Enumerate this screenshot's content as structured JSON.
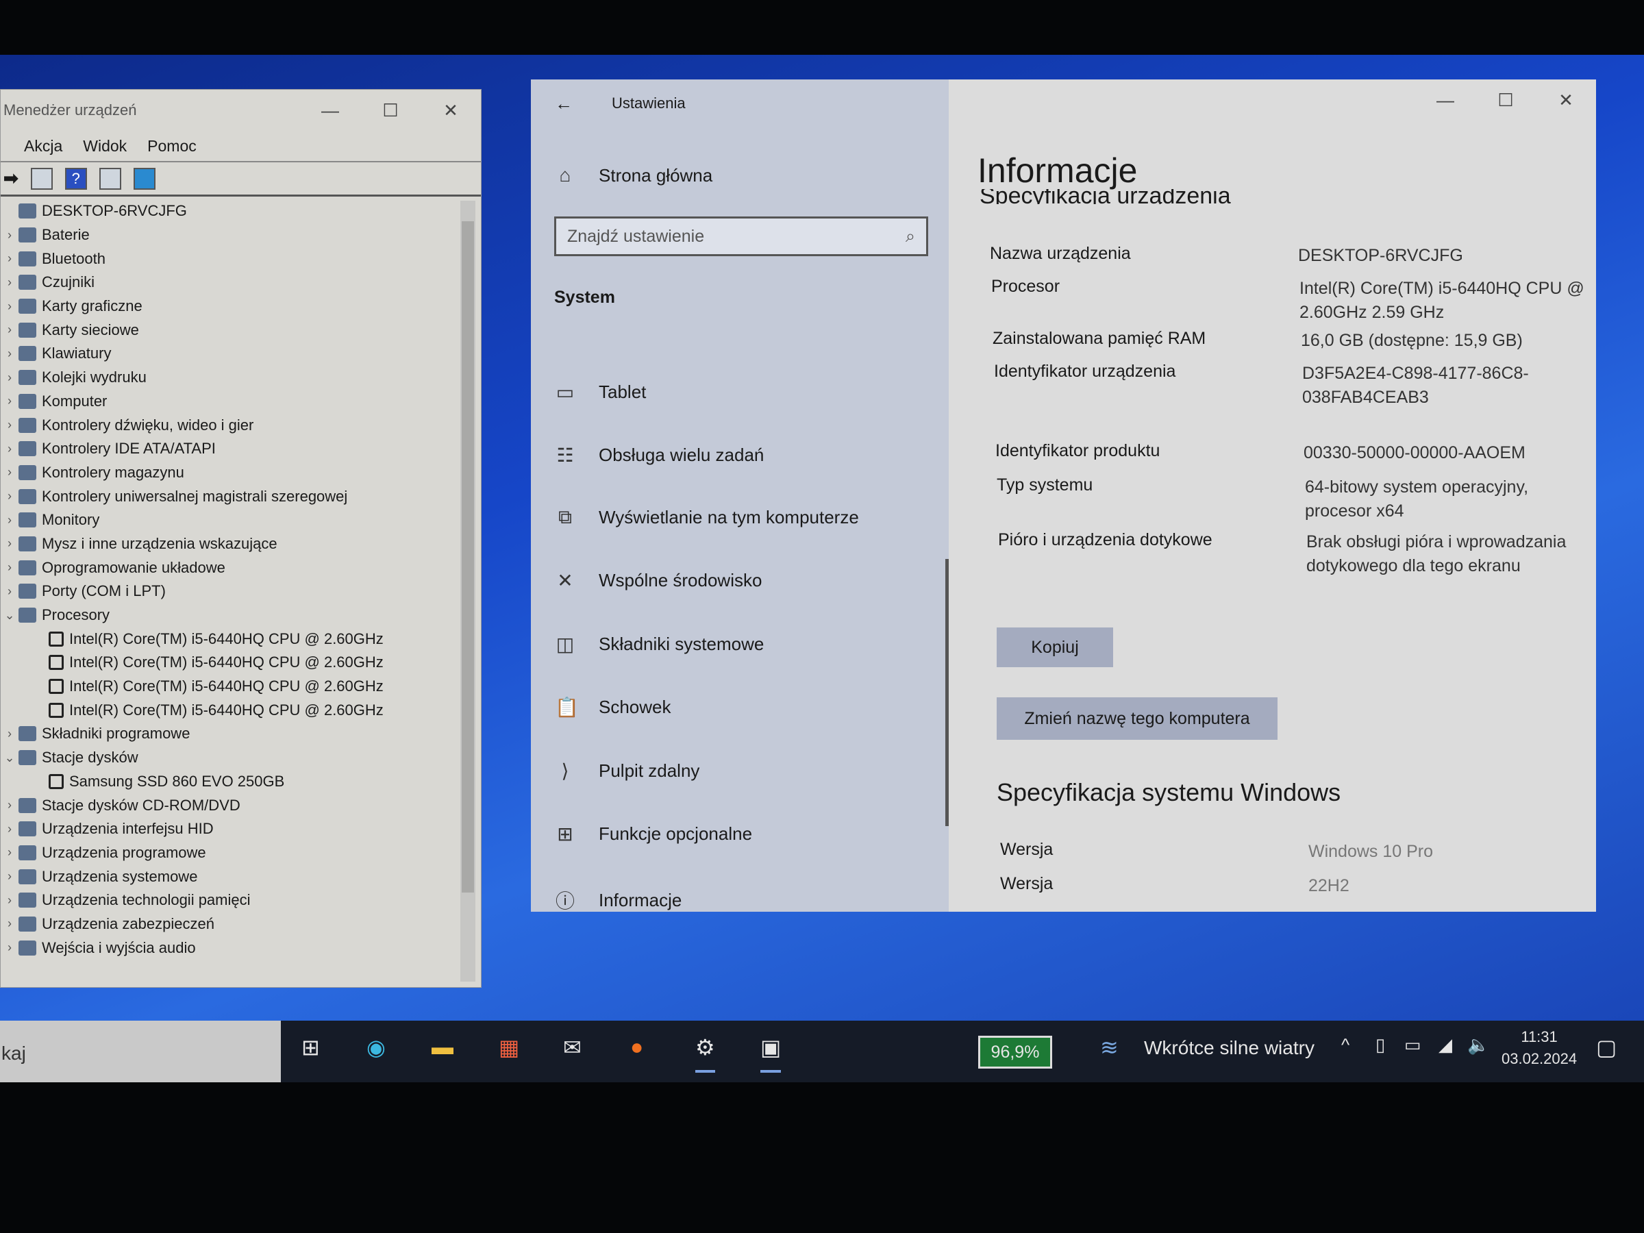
{
  "device_manager": {
    "title": "Menedżer urządzeń",
    "menu": [
      "Akcja",
      "Widok",
      "Pomoc"
    ],
    "tree": [
      {
        "label": "DESKTOP-6RVCJFG",
        "level": 0
      },
      {
        "label": "Baterie",
        "state": "collapsed"
      },
      {
        "label": "Bluetooth",
        "state": "collapsed"
      },
      {
        "label": "Czujniki",
        "state": "collapsed"
      },
      {
        "label": "Karty graficzne",
        "state": "collapsed"
      },
      {
        "label": "Karty sieciowe",
        "state": "collapsed"
      },
      {
        "label": "Klawiatury",
        "state": "collapsed"
      },
      {
        "label": "Kolejki wydruku",
        "state": "collapsed"
      },
      {
        "label": "Komputer",
        "state": "collapsed"
      },
      {
        "label": "Kontrolery dźwięku, wideo i gier",
        "state": "collapsed"
      },
      {
        "label": "Kontrolery IDE ATA/ATAPI",
        "state": "collapsed"
      },
      {
        "label": "Kontrolery magazynu",
        "state": "collapsed"
      },
      {
        "label": "Kontrolery uniwersalnej magistrali szeregowej",
        "state": "collapsed"
      },
      {
        "label": "Monitory",
        "state": "collapsed"
      },
      {
        "label": "Mysz i inne urządzenia wskazujące",
        "state": "collapsed"
      },
      {
        "label": "Oprogramowanie układowe",
        "state": "collapsed"
      },
      {
        "label": "Porty (COM i LPT)",
        "state": "collapsed"
      },
      {
        "label": "Procesory",
        "state": "expanded"
      },
      {
        "label": "Intel(R) Core(TM) i5-6440HQ CPU @ 2.60GHz",
        "level": 2
      },
      {
        "label": "Intel(R) Core(TM) i5-6440HQ CPU @ 2.60GHz",
        "level": 2
      },
      {
        "label": "Intel(R) Core(TM) i5-6440HQ CPU @ 2.60GHz",
        "level": 2
      },
      {
        "label": "Intel(R) Core(TM) i5-6440HQ CPU @ 2.60GHz",
        "level": 2
      },
      {
        "label": "Składniki programowe",
        "state": "collapsed"
      },
      {
        "label": "Stacje dysków",
        "state": "expanded"
      },
      {
        "label": "Samsung SSD 860 EVO 250GB",
        "level": 2
      },
      {
        "label": "Stacje dysków CD-ROM/DVD",
        "state": "collapsed"
      },
      {
        "label": "Urządzenia interfejsu HID",
        "state": "collapsed"
      },
      {
        "label": "Urządzenia programowe",
        "state": "collapsed"
      },
      {
        "label": "Urządzenia systemowe",
        "state": "collapsed"
      },
      {
        "label": "Urządzenia technologii pamięci",
        "state": "collapsed"
      },
      {
        "label": "Urządzenia zabezpieczeń",
        "state": "collapsed"
      },
      {
        "label": "Wejścia i wyjścia audio",
        "state": "collapsed"
      }
    ]
  },
  "settings": {
    "title": "Ustawienia",
    "home": "Strona główna",
    "search_placeholder": "Znajdź ustawienie",
    "section": "System",
    "nav": [
      {
        "label": "Tablet",
        "icon": "tablet-icon"
      },
      {
        "label": "Obsługa wielu zadań",
        "icon": "multitask-icon"
      },
      {
        "label": "Wyświetlanie na tym komputerze",
        "icon": "project-icon"
      },
      {
        "label": "Wspólne środowisko",
        "icon": "shared-icon"
      },
      {
        "label": "Składniki systemowe",
        "icon": "components-icon"
      },
      {
        "label": "Schowek",
        "icon": "clipboard-icon"
      },
      {
        "label": "Pulpit zdalny",
        "icon": "remote-icon"
      },
      {
        "label": "Funkcje opcjonalne",
        "icon": "features-icon"
      },
      {
        "label": "Informacje",
        "icon": "info-icon"
      }
    ],
    "page_title": "Informacje",
    "section_partial": "Specyfikacja urządzenia",
    "specs": [
      {
        "k": "Nazwa urządzenia",
        "v": "DESKTOP-6RVCJFG"
      },
      {
        "k": "Procesor",
        "v": "Intel(R) Core(TM) i5-6440HQ CPU @ 2.60GHz   2.59 GHz"
      },
      {
        "k": "Zainstalowana pamięć RAM",
        "v": "16,0 GB (dostępne: 15,9 GB)"
      },
      {
        "k": "Identyfikator urządzenia",
        "v": "D3F5A2E4-C898-4177-86C8-038FAB4CEAB3"
      },
      {
        "k": "Identyfikator produktu",
        "v": "00330-50000-00000-AAOEM"
      },
      {
        "k": "Typ systemu",
        "v": "64-bitowy system operacyjny, procesor x64"
      },
      {
        "k": "Pióro i urządzenia dotykowe",
        "v": "Brak obsługi pióra i wprowadzania dotykowego dla tego ekranu"
      }
    ],
    "copy_button": "Kopiuj",
    "rename_button": "Zmień nazwę tego komputera",
    "windows_section": "Specyfikacja systemu Windows",
    "win_specs": [
      {
        "k": "Wersja",
        "v": "Windows 10 Pro"
      },
      {
        "k": "Wersja",
        "v": "22H2"
      }
    ]
  },
  "taskbar": {
    "search_partial": "kaj",
    "battery": "96,9%",
    "weather": "Wkrótce silne wiatry",
    "time": "11:31",
    "date": "03.02.2024"
  }
}
